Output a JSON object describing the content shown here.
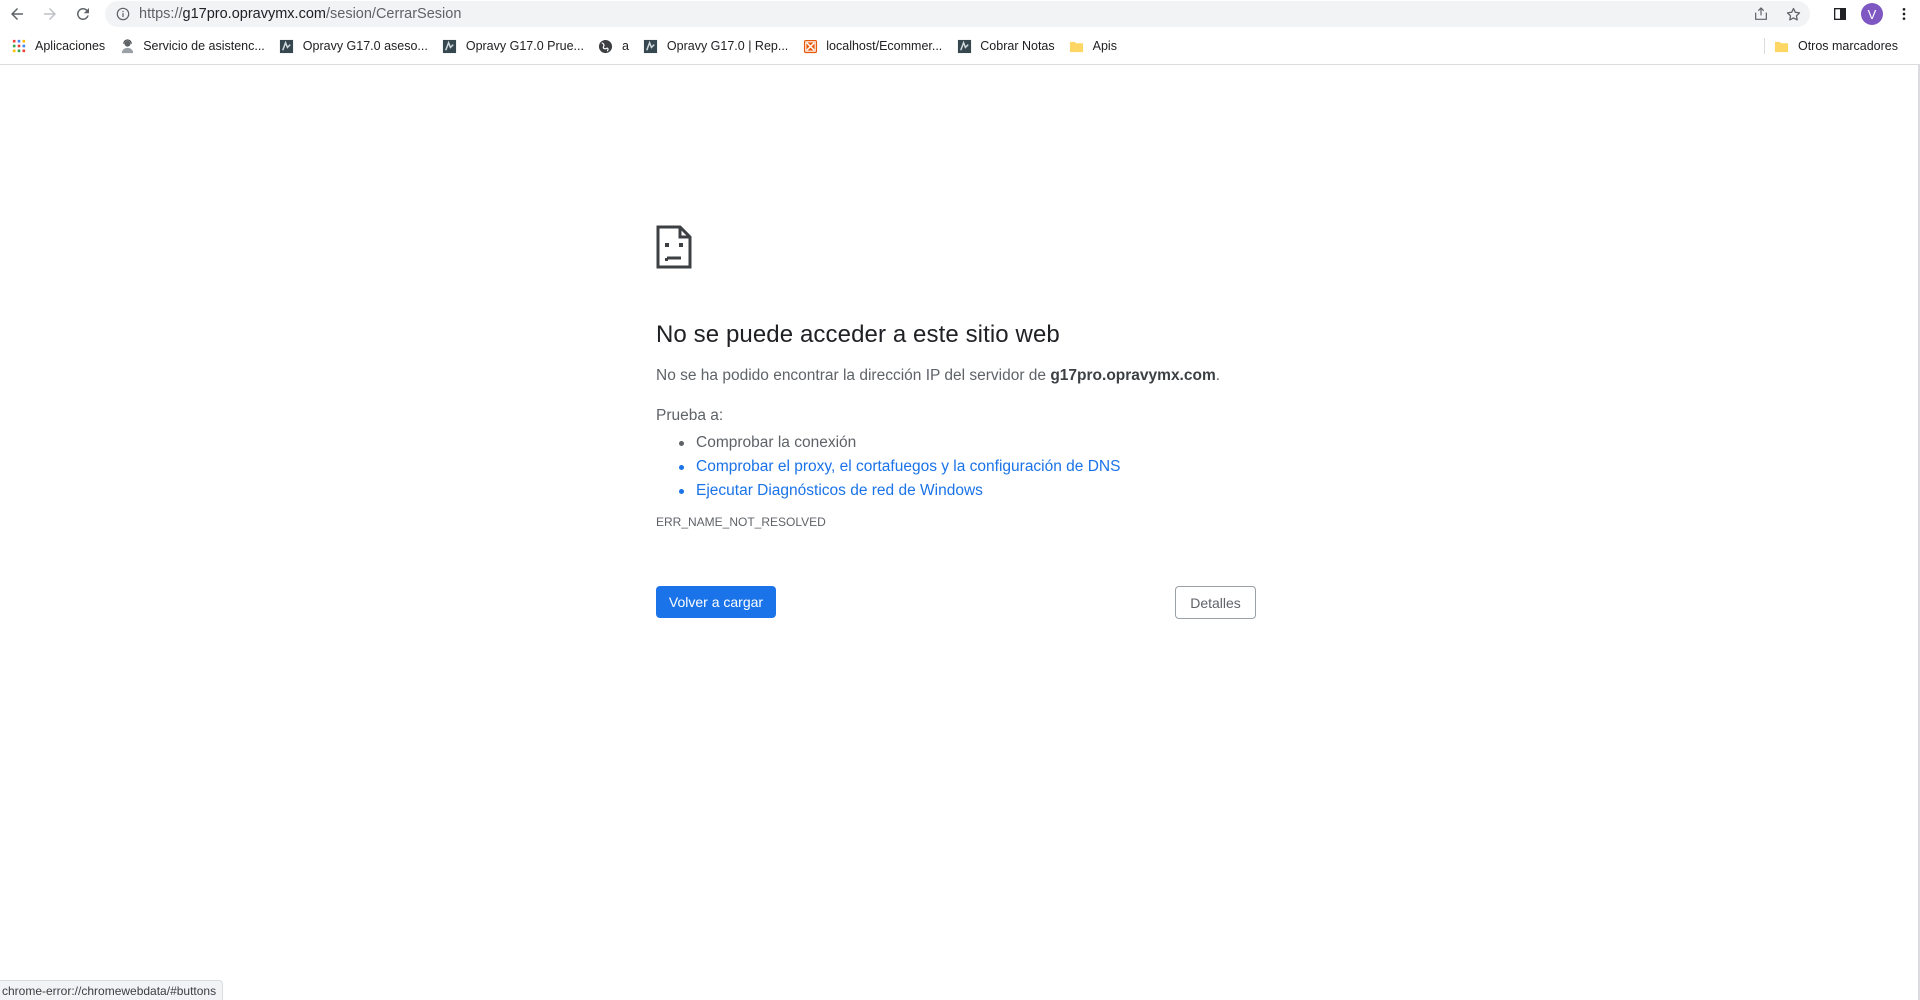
{
  "browser": {
    "url": {
      "scheme": "https://",
      "host": "g17pro.opravymx.com",
      "path": "/sesion/CerrarSesion"
    },
    "avatar_letter": "V",
    "accent_color": "#1a73e8"
  },
  "bookmarks": {
    "items": [
      {
        "label": "Aplicaciones",
        "icon": "apps-grid-icon"
      },
      {
        "label": "Servicio de asistenc...",
        "icon": "support-person-icon"
      },
      {
        "label": "Opravy G17.0 aseso...",
        "icon": "opravy-site-icon"
      },
      {
        "label": "Opravy G17.0 Prue...",
        "icon": "opravy-site-icon"
      },
      {
        "label": "a",
        "icon": "globe-icon"
      },
      {
        "label": "Opravy G17.0 | Rep...",
        "icon": "opravy-site-icon"
      },
      {
        "label": "localhost/Ecommer...",
        "icon": "localhost-icon"
      },
      {
        "label": "Cobrar Notas",
        "icon": "opravy-site-icon"
      },
      {
        "label": "Apis",
        "icon": "folder-icon"
      }
    ],
    "other_label": "Otros marcadores"
  },
  "error": {
    "title": "No se puede acceder a este sitio web",
    "desc_prefix": "No se ha podido encontrar la dirección IP del servidor de ",
    "desc_host": "g17pro.opravymx.com",
    "desc_suffix": ".",
    "try_label": "Prueba a:",
    "suggestions": [
      "Comprobar la conexión",
      "Comprobar el proxy, el cortafuegos y la configuración de DNS",
      "Ejecutar Diagnósticos de red de Windows"
    ],
    "code": "ERR_NAME_NOT_RESOLVED",
    "reload_label": "Volver a cargar",
    "details_label": "Detalles"
  },
  "status_bar": {
    "text": "chrome-error://chromewebdata/#buttons"
  }
}
